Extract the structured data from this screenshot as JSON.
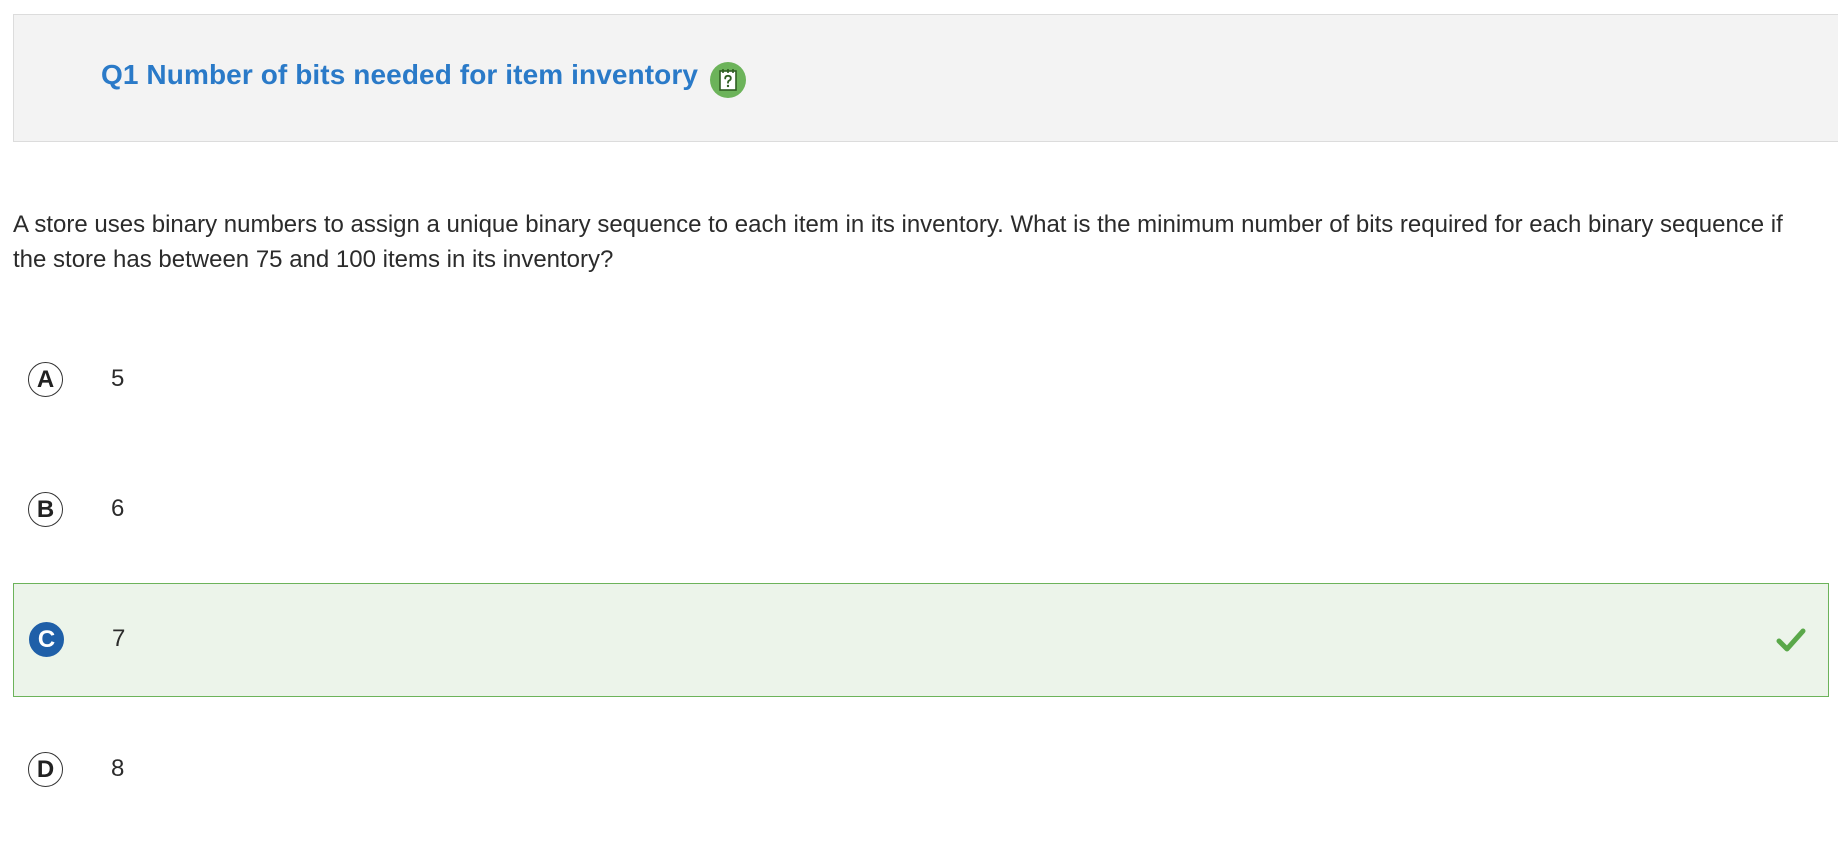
{
  "header": {
    "title": "Q1 Number of bits needed for item inventory",
    "help_icon": "help-notebook-icon"
  },
  "question": {
    "text": "A store uses binary numbers to assign a unique binary sequence to each item in its inventory. What is the minimum number of bits required for each binary sequence if the store has between 75 and 100 items in its inventory?"
  },
  "choices": [
    {
      "letter": "A",
      "text": "5",
      "selected": false,
      "correct": false
    },
    {
      "letter": "B",
      "text": "6",
      "selected": false,
      "correct": false
    },
    {
      "letter": "C",
      "text": "7",
      "selected": true,
      "correct": true
    },
    {
      "letter": "D",
      "text": "8",
      "selected": false,
      "correct": false
    }
  ],
  "colors": {
    "title": "#2a7ac8",
    "help_icon_bg": "#6cb35a",
    "correct_bg": "#ecf4ea",
    "correct_border": "#6cb35a",
    "selected_letter_bg": "#1f5fa8",
    "check": "#5aa84a"
  },
  "icons": {
    "correct_indicator": "checkmark-icon"
  }
}
